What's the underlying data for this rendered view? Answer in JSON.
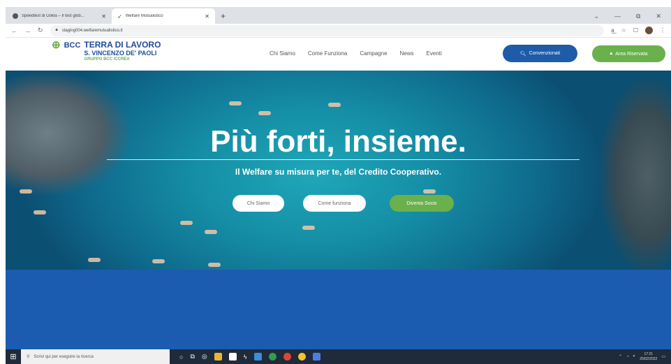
{
  "browser": {
    "tabs": [
      {
        "title": "Speedtest di Ookla – Il test glob...",
        "active": false
      },
      {
        "title": "Welfare Mutualistico",
        "active": true
      }
    ],
    "new_tab_label": "+",
    "url": "staging004.welfaremutualistico.it"
  },
  "site": {
    "logo": {
      "mark": "BCC",
      "line1": "TERRA DI LAVORO",
      "line2": "S. VINCENZO DE' PAOLI",
      "line3": "GRUPPO BCC ICCREA"
    },
    "nav": [
      "Chi Siamo",
      "Come Funziona",
      "Campagne",
      "News",
      "Eventi"
    ],
    "convenzionati_label": "Convenzionati",
    "area_riservata_label": "Area Riservata"
  },
  "hero": {
    "title": "Più forti, insieme.",
    "subtitle": "Il Welfare su misura per te, del Credito Cooperativo.",
    "buttons": [
      "Chi Siamo",
      "Come funziona",
      "Diventa Socio"
    ]
  },
  "taskbar": {
    "search_placeholder": "Scrivi qui per eseguire la ricerca",
    "time": "17:21",
    "date": "25/02/2022"
  },
  "colors": {
    "brand_blue": "#1e5ba8",
    "brand_green": "#6ab04c",
    "band_blue": "#1b5cb0"
  }
}
